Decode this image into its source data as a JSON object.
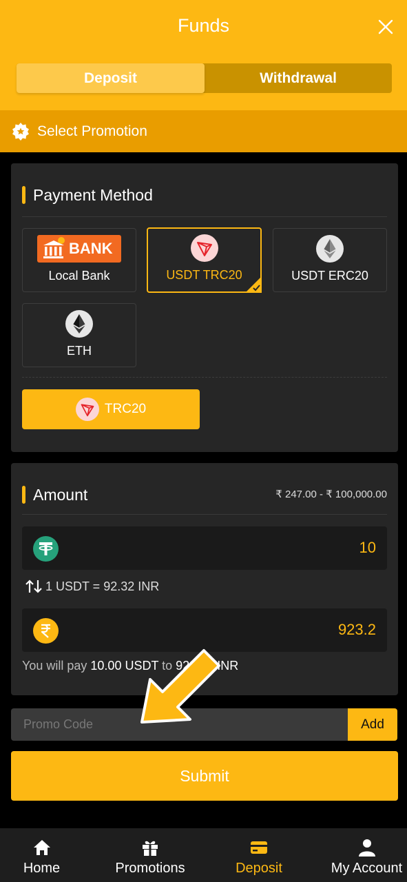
{
  "header": {
    "title": "Funds",
    "tabs": [
      {
        "label": "Deposit",
        "active": true
      },
      {
        "label": "Withdrawal",
        "active": false
      }
    ]
  },
  "promotion": {
    "label": "Select Promotion"
  },
  "payment": {
    "title": "Payment Method",
    "methods": [
      {
        "label": "Local Bank",
        "logo_text": "BANK",
        "icon": "bank-icon"
      },
      {
        "label": "USDT TRC20",
        "icon": "tron-icon",
        "selected": true
      },
      {
        "label": "USDT ERC20",
        "icon": "ethereum-icon"
      },
      {
        "label": "ETH",
        "icon": "ethereum-icon"
      }
    ],
    "channel_label": "TRC20"
  },
  "amount": {
    "title": "Amount",
    "range": "₹ 247.00 - ₹ 100,000.00",
    "usdt_value": "10",
    "rate": "1 USDT = 92.32 INR",
    "inr_value": "923.2",
    "pay_note_prefix": "You will pay ",
    "pay_note_usdt": "10.00 USDT",
    "pay_note_mid": " to ",
    "pay_note_inr": "923.20 INR"
  },
  "promo_code": {
    "placeholder": "Promo Code",
    "add_label": "Add"
  },
  "submit_label": "Submit",
  "nav": [
    {
      "label": "Home",
      "icon": "home-icon"
    },
    {
      "label": "Promotions",
      "icon": "gift-icon"
    },
    {
      "label": "Deposit",
      "icon": "card-icon",
      "active": true
    },
    {
      "label": "My Account",
      "icon": "user-icon"
    }
  ],
  "colors": {
    "accent": "#fdb813",
    "card": "#262626",
    "background": "#000000"
  }
}
